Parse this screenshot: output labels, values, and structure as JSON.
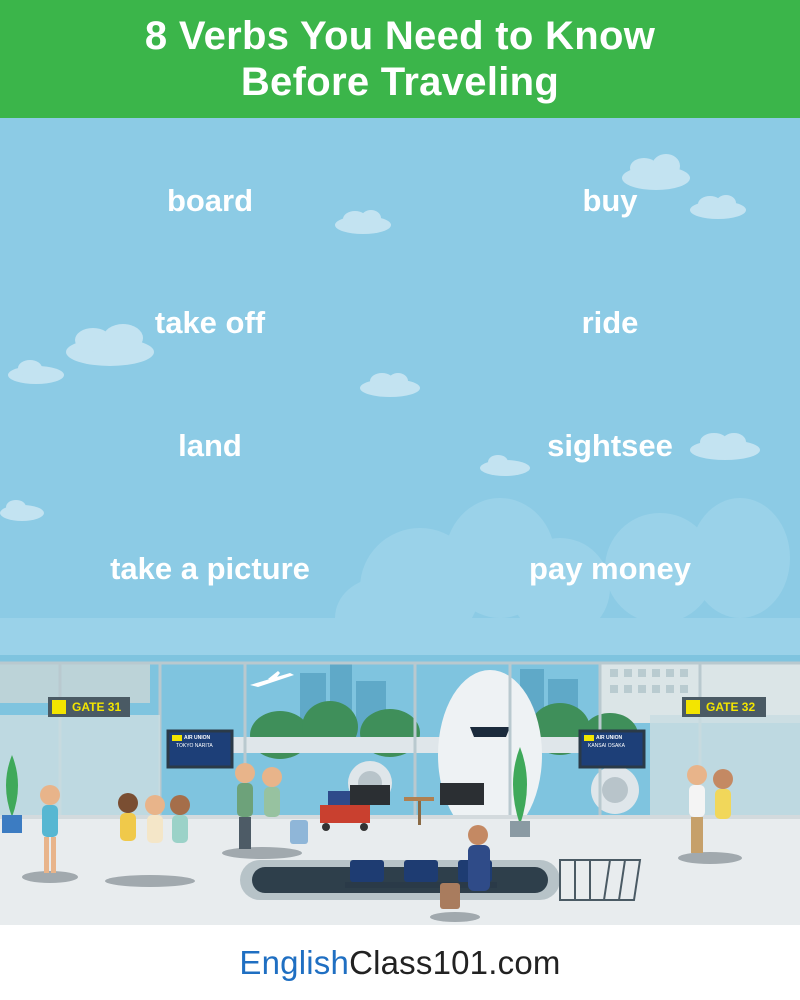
{
  "header": {
    "title_line1": "8 Verbs You Need to Know",
    "title_line2": "Before Traveling"
  },
  "verbs": {
    "left": [
      "board",
      "take off",
      "land",
      "take a picture"
    ],
    "right": [
      "buy",
      "ride",
      "sightsee",
      "pay money"
    ]
  },
  "scene": {
    "gate_left": "GATE 31",
    "gate_right": "GATE 32",
    "board_left_airline": "AIR UNION",
    "board_left_dest": "TOKYO NARITA",
    "board_right_airline": "AIR UNION",
    "board_right_dest": "KANSAI OSAKA"
  },
  "footer": {
    "brand_part1": "English",
    "brand_part2": "Class101",
    "brand_part3": ".com"
  },
  "colors": {
    "header_green": "#3bb54a",
    "sky_blue": "#8ccbe5",
    "brand_blue": "#1f6fc2",
    "gate_yellow": "#f3e500"
  }
}
